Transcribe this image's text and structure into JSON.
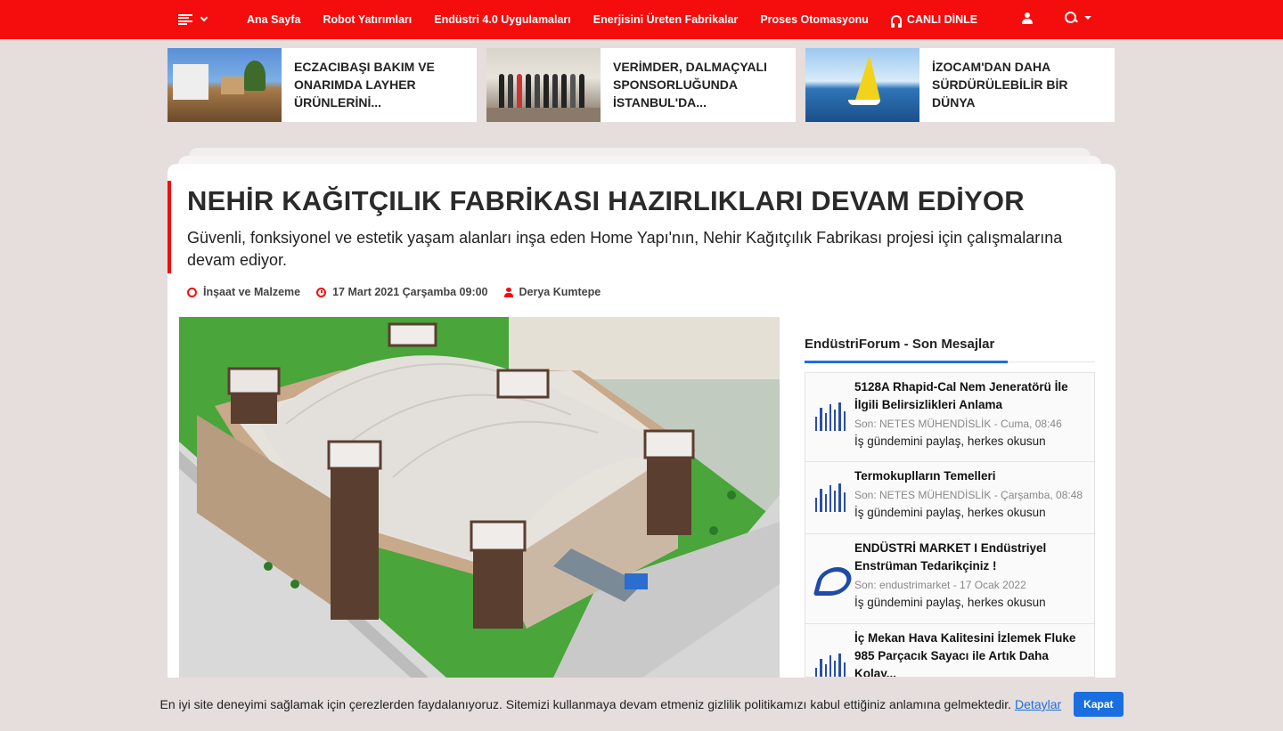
{
  "nav": {
    "links": [
      "Ana Sayfa",
      "Robot Yatırımları",
      "Endüstri 4.0 Uygulamaları",
      "Enerjisini Üreten Fabrikalar",
      "Proses Otomasyonu"
    ],
    "radio_label": "CANLI DİNLE",
    "accent": "#f50c0c"
  },
  "cards": [
    {
      "title": "ECZACIBAŞI BAKIM VE ONARIMDA LAYHER ÜRÜNLERİNİ..."
    },
    {
      "title": "VERİMDER, DALMAÇYALI SPONSORLUĞUNDA İSTANBUL'DA..."
    },
    {
      "title": "İZOCAM'DAN DAHA SÜRDÜRÜLEBİLİR BİR DÜNYA"
    }
  ],
  "article": {
    "headline": "NEHİR KAĞITÇILIK FABRİKASI HAZIRLIKLARI DEVAM EDİYOR",
    "lead": "Güvenli, fonksiyonel ve estetik yaşam alanları inşa eden Home Yapı'nın, Nehir Kağıtçılık Fabrikası projesi için çalışmalarına devam ediyor.",
    "category": "İnşaat ve Malzeme",
    "date": "17 Mart 2021 Çarşamba 09:00",
    "author": "Derya Kumtepe"
  },
  "sidebar": {
    "title": "EndüstriForum - Son Mesajlar",
    "items": [
      {
        "title": "5128A Rhapid-Cal Nem Jeneratörü İle İlgili Belirsizlikleri Anlama",
        "sub": "Son: NETES MÜHENDİSLİK - Cuma, 08:46",
        "desc": "İş gündemini paylaş, herkes okusun",
        "logo": "netes-logo"
      },
      {
        "title": "Termokuplların Temelleri",
        "sub": "Son: NETES MÜHENDİSLİK - Çarşamba, 08:48",
        "desc": "İş gündemini paylaş, herkes okusun",
        "logo": "netes-logo"
      },
      {
        "title": "ENDÜSTRİ MARKET I Endüstriyel Enstrüman Tedarikçiniz !",
        "sub": "Son: endustrimarket - 17 Ocak 2022",
        "desc": "İş gündemini paylaş, herkes okusun",
        "logo": "endustrimarket-logo"
      },
      {
        "title": "İç Mekan Hava Kalitesini İzlemek Fluke 985 Parçacık Sayacı ile Artık Daha Kolay...",
        "sub": "",
        "desc": "",
        "logo": "netes-logo"
      }
    ]
  },
  "cookie": {
    "message": "En iyi site deneyimi sağlamak için çerezlerden faydalanıyoruz. Sitemizi kullanmaya devam etmeniz gizlilik politikamızı kabul ettiğiniz anlamına gelmektedir.",
    "link": "Detaylar",
    "button": "Kapat"
  }
}
